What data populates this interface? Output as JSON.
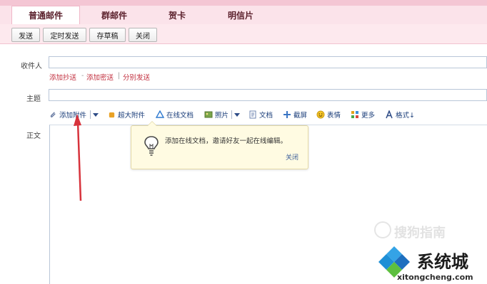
{
  "tabs": [
    {
      "label": "普通邮件",
      "active": true
    },
    {
      "label": "群邮件",
      "active": false
    },
    {
      "label": "贺卡",
      "active": false
    },
    {
      "label": "明信片",
      "active": false
    }
  ],
  "toolbar": {
    "send": "发送",
    "scheduled_send": "定时发送",
    "save_draft": "存草稿",
    "close": "关闭"
  },
  "form": {
    "recipient_label": "收件人",
    "recipient_value": "",
    "add_cc": "添加抄送",
    "dash": "-",
    "add_bcc": "添加密送",
    "pipe": "|",
    "separate_send": "分别发送",
    "subject_label": "主题",
    "subject_value": "",
    "body_label": "正文"
  },
  "editor_tools": [
    {
      "label": "添加附件",
      "icon": "paperclip-icon",
      "dropdown": true
    },
    {
      "label": "超大附件",
      "icon": "large-attachment-icon",
      "dropdown": false
    },
    {
      "label": "在线文档",
      "icon": "online-doc-icon",
      "dropdown": false
    },
    {
      "label": "照片",
      "icon": "photo-icon",
      "dropdown": true
    },
    {
      "label": "文档",
      "icon": "document-icon",
      "dropdown": false
    },
    {
      "label": "截屏",
      "icon": "screenshot-icon",
      "dropdown": false
    },
    {
      "label": "表情",
      "icon": "emoji-icon",
      "dropdown": false
    },
    {
      "label": "更多",
      "icon": "more-icon",
      "dropdown": false
    },
    {
      "label": "格式↓",
      "icon": "format-icon",
      "dropdown": false
    }
  ],
  "tooltip": {
    "text": "添加在线文档，邀请好友一起在线编辑。",
    "close": "关闭"
  },
  "watermark": {
    "text": "搜狗指南",
    "logo_main": "系统城",
    "logo_sub": "xitongcheng.com"
  },
  "colors": {
    "accent": "#c2303f",
    "tab_bg": "#fbe3ea",
    "toolbar_bg": "#fde9ee",
    "arrow": "#d7333c",
    "logo_blue": "#1e8fd6"
  }
}
